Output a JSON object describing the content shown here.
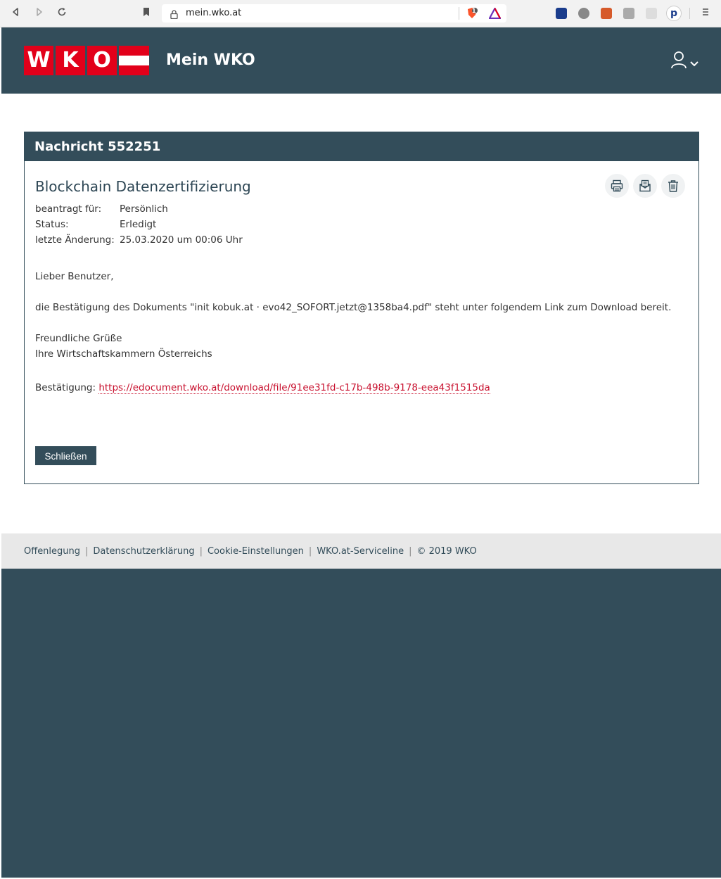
{
  "browser": {
    "url": "mein.wko.at",
    "shield_count": "1"
  },
  "header": {
    "logo_letters": [
      "W",
      "K",
      "O"
    ],
    "title": "Mein WKO"
  },
  "message": {
    "heading": "Nachricht 552251",
    "title": "Blockchain Datenzertifizierung",
    "meta": [
      {
        "label": "beantragt für:",
        "value": "Persönlich"
      },
      {
        "label": "Status:",
        "value": "Erledigt"
      },
      {
        "label": "letzte Änderung:",
        "value": "25.03.2020 um 00:06 Uhr"
      }
    ],
    "greeting": "Lieber Benutzer,",
    "body": "die Bestätigung des Dokuments \"init kobuk.at · evo42_SOFORT.jetzt@1358ba4.pdf\" steht unter folgendem Link zum Download bereit.",
    "closing_1": "Freundliche Grüße",
    "closing_2": "Ihre Wirtschaftskammern Österreichs",
    "confirmation_label": "Bestätigung:",
    "confirmation_link": "https://edocument.wko.at/download/file/91ee31fd-c17b-498b-9178-eea43f1515da",
    "close_label": "Schließen"
  },
  "footer": {
    "links": [
      "Offenlegung",
      "Datenschutzerklärung",
      "Cookie-Einstellungen",
      "WKO.at-Serviceline"
    ],
    "copyright": "© 2019 WKO"
  },
  "colors": {
    "primary": "#334d5a",
    "brand_red": "#e2001a",
    "link_red": "#c8102e"
  },
  "icons": [
    "back-icon",
    "forward-icon",
    "reload-icon",
    "bookmark-icon",
    "lock-icon",
    "brave-shield-icon",
    "user-icon",
    "chevron-down-icon",
    "print-icon",
    "mail-icon",
    "trash-icon",
    "menu-icon"
  ]
}
